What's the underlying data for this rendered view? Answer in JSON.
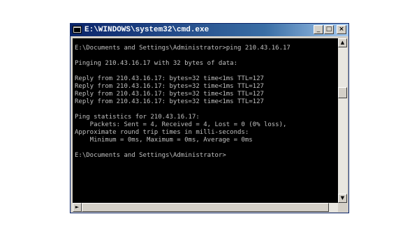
{
  "window": {
    "title": "E:\\WINDOWS\\system32\\cmd.exe",
    "buttons": {
      "minimize": "_",
      "maximize": "□",
      "close": "×"
    }
  },
  "console": {
    "lines": [
      "E:\\Documents and Settings\\Administrator>ping 210.43.16.17",
      "",
      "Pinging 210.43.16.17 with 32 bytes of data:",
      "",
      "Reply from 210.43.16.17: bytes=32 time<1ms TTL=127",
      "Reply from 210.43.16.17: bytes=32 time<1ms TTL=127",
      "Reply from 210.43.16.17: bytes=32 time<1ms TTL=127",
      "Reply from 210.43.16.17: bytes=32 time<1ms TTL=127",
      "",
      "Ping statistics for 210.43.16.17:",
      "    Packets: Sent = 4, Received = 4, Lost = 0 (0% loss),",
      "Approximate round trip times in milli-seconds:",
      "    Minimum = 0ms, Maximum = 0ms, Average = 0ms",
      "",
      "E:\\Documents and Settings\\Administrator>"
    ]
  },
  "scrollbars": {
    "arrows": {
      "up": "▲",
      "down": "▼",
      "left": "◄",
      "right": "►"
    }
  },
  "colors": {
    "title_gradient_start": "#0a246a",
    "title_gradient_end": "#a6caf0",
    "console_background": "#000000",
    "console_text": "#c0c0c0",
    "chrome": "#d4d0c8"
  },
  "icons": {
    "app": "cmd-icon"
  }
}
